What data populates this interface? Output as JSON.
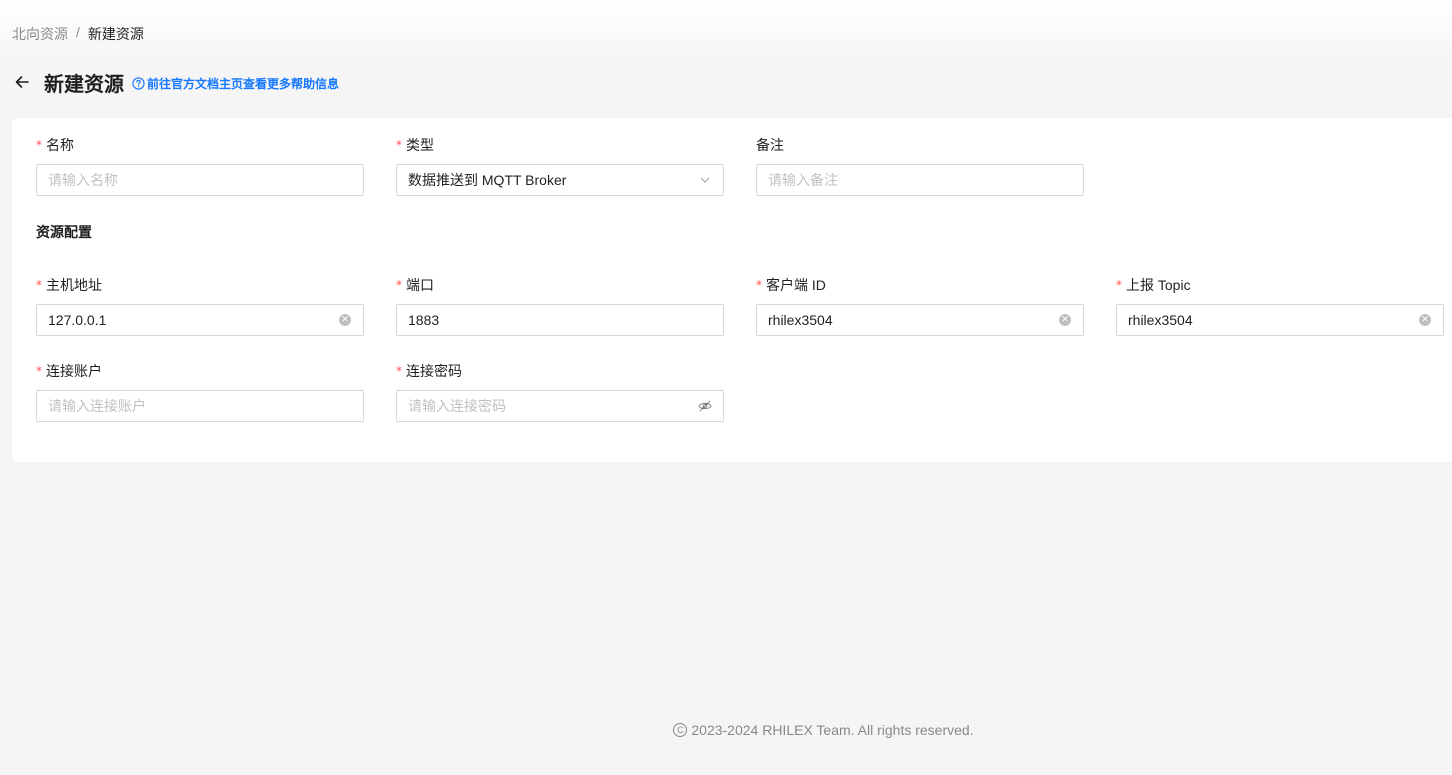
{
  "breadcrumb": {
    "parent": "北向资源",
    "separator": "/",
    "current": "新建资源"
  },
  "header": {
    "title": "新建资源",
    "help_link": "前往官方文档主页查看更多帮助信息"
  },
  "form": {
    "name": {
      "label": "名称",
      "required": true,
      "placeholder": "请输入名称",
      "value": ""
    },
    "type": {
      "label": "类型",
      "required": true,
      "value": "数据推送到 MQTT Broker"
    },
    "remark": {
      "label": "备注",
      "required": false,
      "placeholder": "请输入备注",
      "value": ""
    },
    "section_title": "资源配置",
    "host": {
      "label": "主机地址",
      "required": true,
      "value": "127.0.0.1"
    },
    "port": {
      "label": "端口",
      "required": true,
      "value": "1883"
    },
    "client_id": {
      "label": "客户端 ID",
      "required": true,
      "value": "rhilex3504"
    },
    "topic": {
      "label": "上报 Topic",
      "required": true,
      "value": "rhilex3504"
    },
    "username": {
      "label": "连接账户",
      "required": true,
      "placeholder": "请输入连接账户",
      "value": ""
    },
    "password": {
      "label": "连接密码",
      "required": true,
      "placeholder": "请输入连接密码",
      "value": ""
    }
  },
  "footer": {
    "text": "2023-2024 RHILEX Team. All rights reserved."
  },
  "colors": {
    "accent": "#1677ff",
    "required": "#ff4d4f",
    "background": "#f5f5f5"
  }
}
